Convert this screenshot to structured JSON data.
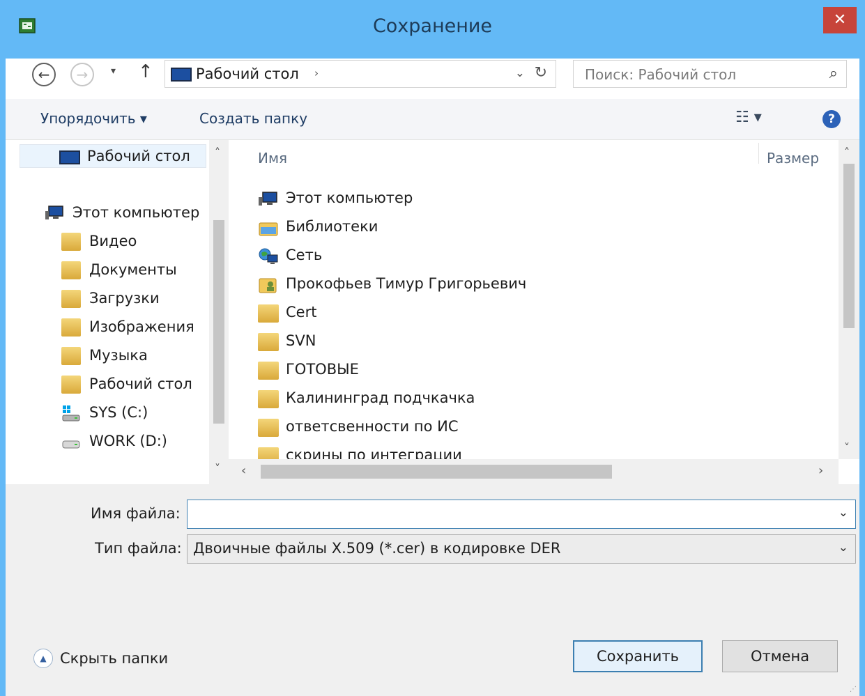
{
  "window": {
    "title": "Сохранение",
    "close_label": "✕"
  },
  "nav": {
    "back_glyph": "←",
    "forward_glyph": "→",
    "recent_glyph": "▾",
    "up_glyph": "↑",
    "address": "Рабочий стол",
    "address_sep": "›",
    "address_dropdown": "⌄",
    "refresh_glyph": "↻",
    "search_placeholder": "Поиск: Рабочий стол",
    "search_glyph": "⌕"
  },
  "toolbar": {
    "organize_label": "Упорядочить ▾",
    "new_folder_label": "Создать папку",
    "view_glyph": "☷ ▾",
    "help_glyph": "?"
  },
  "navpane": {
    "items": [
      {
        "label": "Рабочий стол"
      },
      {
        "label": "Этот компьютер"
      },
      {
        "label": "Видео"
      },
      {
        "label": "Документы"
      },
      {
        "label": "Загрузки"
      },
      {
        "label": "Изображения"
      },
      {
        "label": "Музыка"
      },
      {
        "label": "Рабочий стол"
      },
      {
        "label": "SYS (C:)"
      },
      {
        "label": "WORK (D:)"
      }
    ]
  },
  "filelist": {
    "columns": {
      "name": "Имя",
      "size": "Размер"
    },
    "rows": [
      {
        "label": "Этот компьютер",
        "icon": "computer-icon"
      },
      {
        "label": "Библиотеки",
        "icon": "libraries-icon"
      },
      {
        "label": "Сеть",
        "icon": "network-icon"
      },
      {
        "label": "Прокофьев Тимур Григорьевич",
        "icon": "user-folder-icon"
      },
      {
        "label": "Cert",
        "icon": "folder-icon"
      },
      {
        "label": "SVN",
        "icon": "folder-icon"
      },
      {
        "label": "ГОТОВЫЕ",
        "icon": "folder-icon"
      },
      {
        "label": "Калининград подчкачка",
        "icon": "folder-icon"
      },
      {
        "label": "ответсвенности по ИС",
        "icon": "folder-icon"
      },
      {
        "label": "скрины по интеграции",
        "icon": "folder-icon"
      }
    ]
  },
  "form": {
    "filename_label": "Имя файла:",
    "filename_value": "",
    "filetype_label": "Тип файла:",
    "filetype_value": "Двоичные файлы X.509 (*.cer) в кодировке DER",
    "dropdown_glyph": "⌄"
  },
  "footer": {
    "hide_folders_label": "Скрыть папки",
    "hide_glyph": "▲",
    "save_label": "Сохранить",
    "cancel_label": "Отмена",
    "grip_glyph": "⋰"
  },
  "scroll": {
    "up": "˄",
    "down": "˅",
    "left": "‹",
    "right": "›"
  },
  "colors": {
    "titlebar": "#63b9f6",
    "close": "#c7443a",
    "accent": "#3c7fb1"
  }
}
